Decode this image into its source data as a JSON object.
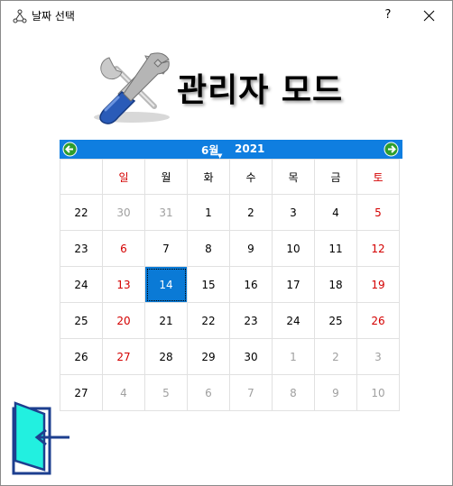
{
  "window": {
    "title": "날짜 선택",
    "help_label": "?"
  },
  "header": {
    "admin_title": "관리자 모드"
  },
  "calendar": {
    "month_label": "6월",
    "year_label": "2021",
    "weekdays": [
      {
        "label": "일",
        "color": "#d40000"
      },
      {
        "label": "월",
        "color": "#000000"
      },
      {
        "label": "화",
        "color": "#000000"
      },
      {
        "label": "수",
        "color": "#000000"
      },
      {
        "label": "목",
        "color": "#000000"
      },
      {
        "label": "금",
        "color": "#000000"
      },
      {
        "label": "토",
        "color": "#d40000"
      }
    ],
    "weeks": [
      {
        "week": "22",
        "days": [
          {
            "d": "30",
            "state": "other"
          },
          {
            "d": "31",
            "state": "other"
          },
          {
            "d": "1",
            "state": "normal"
          },
          {
            "d": "2",
            "state": "normal"
          },
          {
            "d": "3",
            "state": "normal"
          },
          {
            "d": "4",
            "state": "normal"
          },
          {
            "d": "5",
            "state": "holiday"
          }
        ]
      },
      {
        "week": "23",
        "days": [
          {
            "d": "6",
            "state": "holiday"
          },
          {
            "d": "7",
            "state": "normal"
          },
          {
            "d": "8",
            "state": "normal"
          },
          {
            "d": "9",
            "state": "normal"
          },
          {
            "d": "10",
            "state": "normal"
          },
          {
            "d": "11",
            "state": "normal"
          },
          {
            "d": "12",
            "state": "holiday"
          }
        ]
      },
      {
        "week": "24",
        "days": [
          {
            "d": "13",
            "state": "holiday"
          },
          {
            "d": "14",
            "state": "selected"
          },
          {
            "d": "15",
            "state": "normal"
          },
          {
            "d": "16",
            "state": "normal"
          },
          {
            "d": "17",
            "state": "normal"
          },
          {
            "d": "18",
            "state": "normal"
          },
          {
            "d": "19",
            "state": "holiday"
          }
        ]
      },
      {
        "week": "25",
        "days": [
          {
            "d": "20",
            "state": "holiday"
          },
          {
            "d": "21",
            "state": "normal"
          },
          {
            "d": "22",
            "state": "normal"
          },
          {
            "d": "23",
            "state": "normal"
          },
          {
            "d": "24",
            "state": "normal"
          },
          {
            "d": "25",
            "state": "normal"
          },
          {
            "d": "26",
            "state": "holiday"
          }
        ]
      },
      {
        "week": "26",
        "days": [
          {
            "d": "27",
            "state": "holiday"
          },
          {
            "d": "28",
            "state": "normal"
          },
          {
            "d": "29",
            "state": "normal"
          },
          {
            "d": "30",
            "state": "normal"
          },
          {
            "d": "1",
            "state": "other"
          },
          {
            "d": "2",
            "state": "other"
          },
          {
            "d": "3",
            "state": "other"
          }
        ]
      },
      {
        "week": "27",
        "days": [
          {
            "d": "4",
            "state": "other"
          },
          {
            "d": "5",
            "state": "other"
          },
          {
            "d": "6",
            "state": "other"
          },
          {
            "d": "7",
            "state": "other"
          },
          {
            "d": "8",
            "state": "other"
          },
          {
            "d": "9",
            "state": "other"
          },
          {
            "d": "10",
            "state": "other"
          }
        ]
      }
    ],
    "colors": {
      "header_bg": "#0f7ee0",
      "holiday": "#d40000",
      "other_month": "#a0a0a0",
      "normal": "#000000",
      "selected_bg": "#0a7ad6",
      "selected_text": "#ffffff"
    }
  },
  "icons": {
    "app": "app-icon",
    "tools": "tools-icon",
    "prev": "arrow-left-icon",
    "next": "arrow-right-icon",
    "exit": "exit-door-icon"
  }
}
